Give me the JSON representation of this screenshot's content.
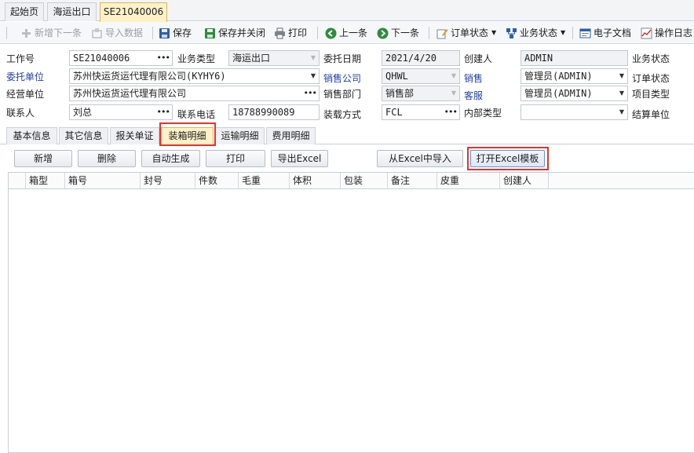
{
  "doc_tabs": [
    "起始页",
    "海运出口",
    "SE21040006"
  ],
  "toolbar": {
    "new_next": "新增下一条",
    "import_data": "导入数据",
    "save": "保存",
    "save_close": "保存并关闭",
    "print": "打印",
    "prev": "上一条",
    "next": "下一条",
    "order_status": "订单状态",
    "business_status": "业务状态",
    "e_docs": "电子文档",
    "op_log": "操作日志"
  },
  "form": {
    "job_no_label": "工作号",
    "job_no": "SE21040006",
    "business_type_label": "业务类型",
    "business_type": "海运出口",
    "entrust_date_label": "委托日期",
    "entrust_date": "2021/4/20",
    "creator_label": "创建人",
    "creator": "ADMIN",
    "business_status_label": "业务状态",
    "client_label": "委托单位",
    "client": "苏州快运货运代理有限公司(KYHY6)",
    "sales_company_label": "销售公司",
    "sales_company": "QHWL",
    "sales_label": "销售",
    "sales": "管理员(ADMIN)",
    "order_status_label": "订单状态",
    "operating_unit_label": "经营单位",
    "operating_unit": "苏州快运货运代理有限公司",
    "sales_dept_label": "销售部门",
    "sales_dept": "销售部",
    "cs_label": "客服",
    "cs": "管理员(ADMIN)",
    "project_type_label": "项目类型",
    "contact_label": "联系人",
    "contact": "刘总",
    "phone_label": "联系电话",
    "phone": "18788990089",
    "load_mode_label": "装载方式",
    "load_mode": "FCL",
    "internal_type_label": "内部类型",
    "internal_type": "",
    "settle_unit_label": "结算单位"
  },
  "sub_tabs": [
    "基本信息",
    "其它信息",
    "报关单证",
    "装箱明细",
    "运输明细",
    "费用明细"
  ],
  "actions": {
    "add": "新增",
    "delete": "删除",
    "auto_gen": "自动生成",
    "print": "打印",
    "export_excel": "导出Excel",
    "import_excel": "从Excel中导入",
    "open_template": "打开Excel模板"
  },
  "grid": {
    "columns": [
      "箱型",
      "箱号",
      "封号",
      "件数",
      "毛重",
      "体积",
      "包装",
      "备注",
      "皮重",
      "创建人"
    ],
    "rows": []
  },
  "colors": {
    "highlight": "#e5322d",
    "active_tab": "#fdf1c8",
    "blue_label": "#1f3fa6"
  }
}
